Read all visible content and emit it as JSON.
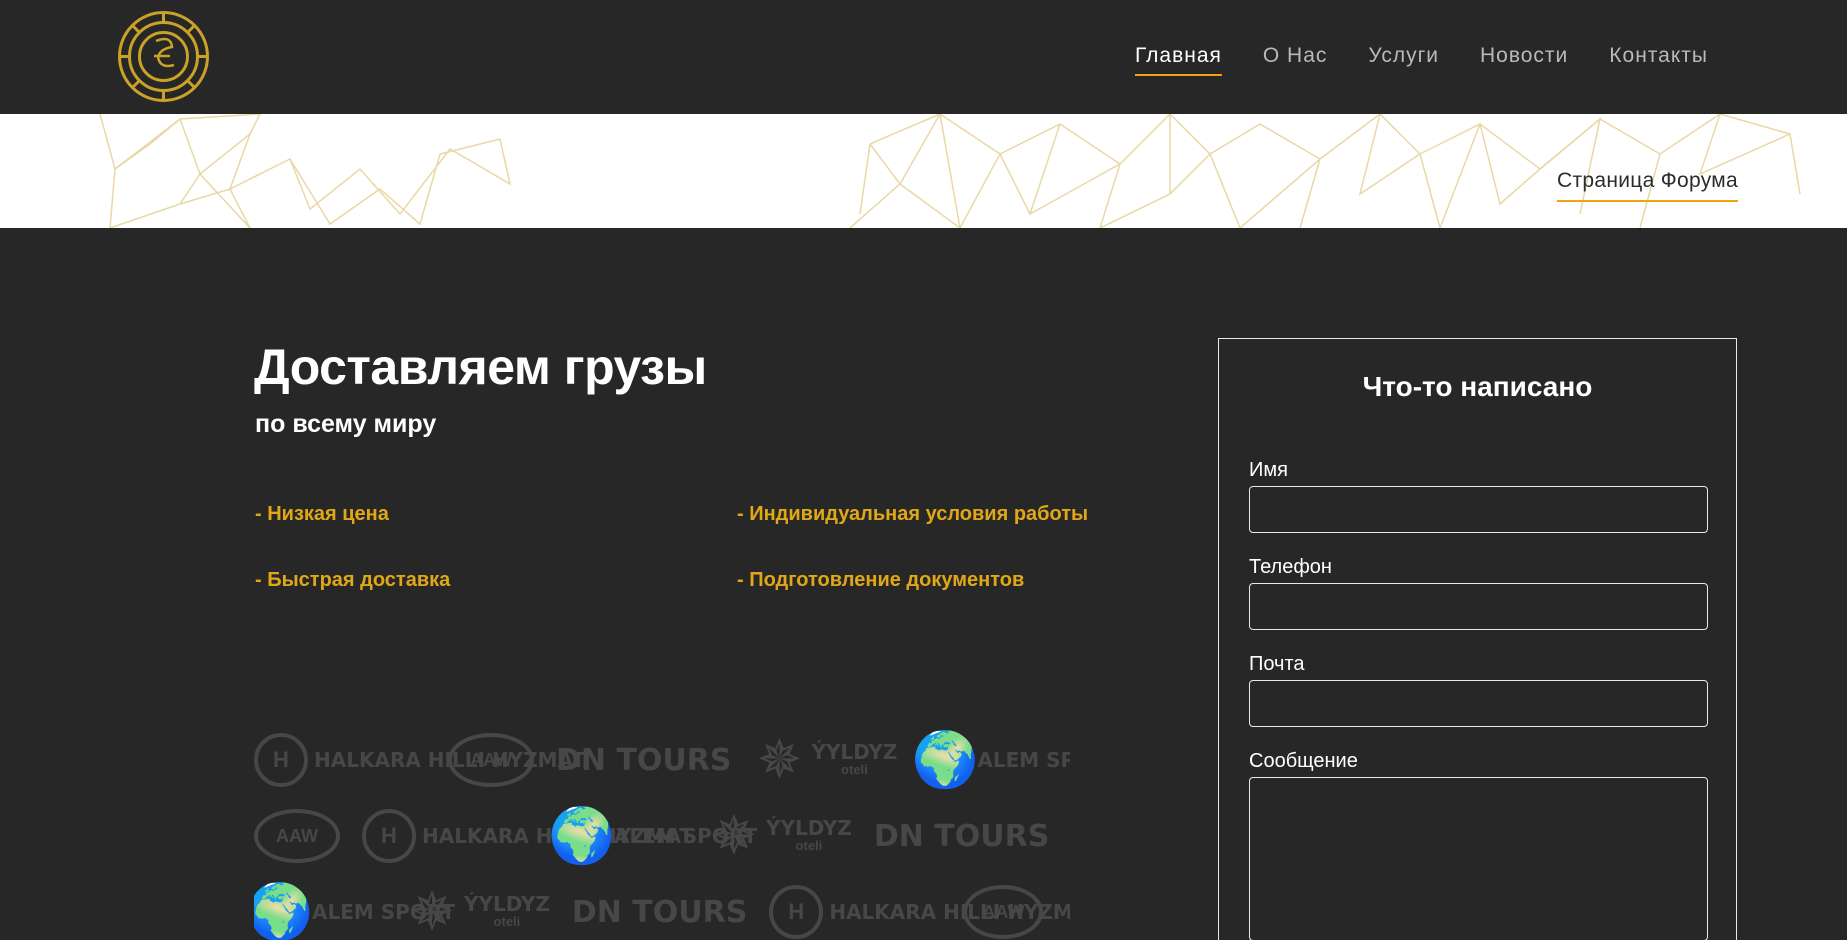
{
  "nav": {
    "items": [
      {
        "label": "Главная",
        "active": true
      },
      {
        "label": "О Нас",
        "active": false
      },
      {
        "label": "Услуги",
        "active": false
      },
      {
        "label": "Новости",
        "active": false
      },
      {
        "label": "Контакты",
        "active": false
      }
    ]
  },
  "band": {
    "forum_link": "Страница Форума"
  },
  "hero": {
    "title": "Доставляем грузы",
    "subtitle": "по всему миру",
    "features": [
      "- Низкая цена",
      "- Индивидуальная условия работы",
      "- Быстрая доставка",
      "- Подготовление документов"
    ]
  },
  "partners": {
    "halkara": "HALKARA HILLI HYZMAT",
    "aaw": "AAW",
    "dn_tours": "DN TOURS",
    "yyldyz": "ÝYLDYZ",
    "yyldyz_sub": "oteli",
    "alem": "ALEM SPORT"
  },
  "form": {
    "title": "Что-то написано",
    "name_label": "Имя",
    "phone_label": "Телефон",
    "email_label": "Почта",
    "message_label": "Сообщение"
  },
  "colors": {
    "background": "#272727",
    "accent": "#f1a40f",
    "feature_text": "#e0a818",
    "logo_gold": "#c9a227",
    "pattern_line": "#e9d8a6"
  }
}
